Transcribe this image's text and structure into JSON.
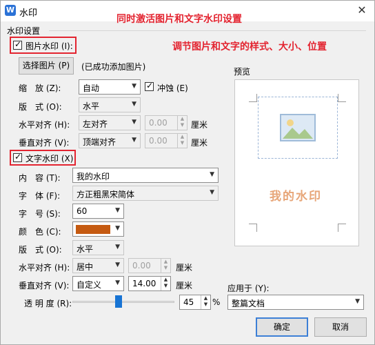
{
  "window": {
    "title": "水印",
    "app_icon_letter": "W",
    "close_glyph": "✕"
  },
  "annotations": {
    "top": "同时激活图片和文字水印设置",
    "middle": "调节图片和文字的样式、大小、位置"
  },
  "group_title": "水印设置",
  "image_watermark": {
    "label": "图片水印 (I):",
    "checked": true,
    "select_button": "选择图片 (P)",
    "status": "(已成功添加图片)",
    "scale_label": "缩　放 (Z):",
    "scale_value": "自动",
    "washout_label": "冲蚀 (E)",
    "washout_checked": true,
    "layout_label": "版　式 (O):",
    "layout_value": "水平",
    "halign_label": "水平对齐 (H):",
    "halign_value": "左对齐",
    "halign_offset": "0.00",
    "halign_unit": "厘米",
    "valign_label": "垂直对齐 (V):",
    "valign_value": "顶端对齐",
    "valign_offset": "0.00",
    "valign_unit": "厘米"
  },
  "text_watermark": {
    "label": "文字水印 (X)",
    "checked": true,
    "content_label": "内　容 (T):",
    "content_value": "我的水印",
    "font_label": "字　体 (F):",
    "font_value": "方正粗黑宋简体",
    "size_label": "字　号 (S):",
    "size_value": "60",
    "color_label": "颜　色 (C):",
    "color_value": "#c55a11",
    "layout_label": "版　式 (O):",
    "layout_value": "水平",
    "halign_label": "水平对齐 (H):",
    "halign_value": "居中",
    "halign_offset": "0.00",
    "halign_unit": "厘米",
    "valign_label": "垂直对齐 (V):",
    "valign_value": "自定义",
    "valign_offset": "14.00",
    "valign_unit": "厘米",
    "transparency_label": "透 明 度 (R):",
    "transparency_value": "45",
    "transparency_fraction": 0.45,
    "transparency_unit": "%"
  },
  "preview": {
    "label": "预览",
    "watermark_text": "我的水印",
    "image_icon": "picture-icon"
  },
  "apply_to": {
    "label": "应用于 (Y):",
    "value": "整篇文档"
  },
  "buttons": {
    "ok": "确定",
    "cancel": "取消"
  },
  "colors": {
    "annotation": "#e3232f",
    "preview_text": "#e7a679",
    "accent": "#1874d4"
  }
}
